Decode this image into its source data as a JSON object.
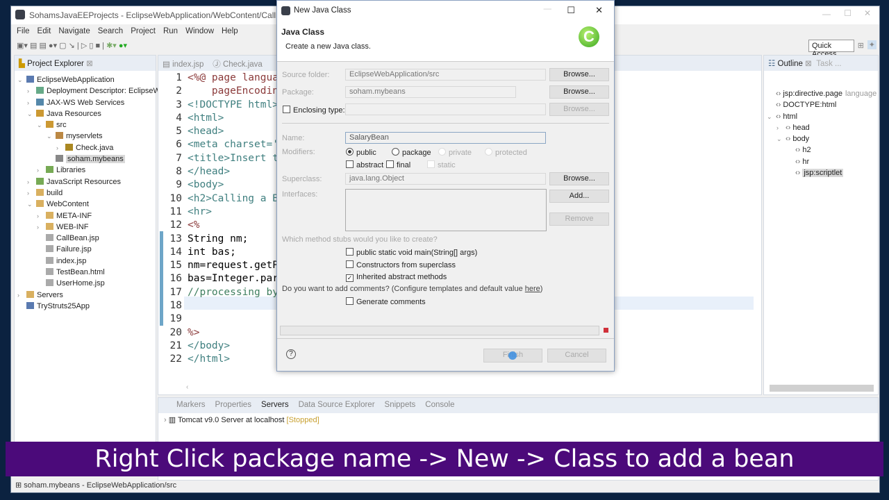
{
  "window": {
    "title": "SohamsJavaEEProjects - EclipseWebApplication/WebContent/CallBean.jsp -"
  },
  "menu": [
    "File",
    "Edit",
    "Navigate",
    "Search",
    "Project",
    "Run",
    "Window",
    "Help"
  ],
  "quick_access": "Quick Access",
  "project_explorer": {
    "title": "Project Explorer",
    "items": [
      {
        "label": "EclipseWebApplication",
        "depth": 0,
        "icon": "project-icon",
        "arrow": "v"
      },
      {
        "label": "Deployment Descriptor: EclipseW",
        "depth": 1,
        "icon": "descriptor-icon",
        "arrow": ">"
      },
      {
        "label": "JAX-WS Web Services",
        "depth": 1,
        "icon": "webservice-icon",
        "arrow": ">"
      },
      {
        "label": "Java Resources",
        "depth": 1,
        "icon": "java-resources-icon",
        "arrow": "v"
      },
      {
        "label": "src",
        "depth": 2,
        "icon": "source-folder-icon",
        "arrow": "v"
      },
      {
        "label": "myservlets",
        "depth": 3,
        "icon": "package-icon",
        "arrow": "v"
      },
      {
        "label": "Check.java",
        "depth": 4,
        "icon": "java-file-icon",
        "arrow": ">"
      },
      {
        "label": "soham.mybeans",
        "depth": 3,
        "icon": "empty-package-icon",
        "arrow": "",
        "selected": true
      },
      {
        "label": "Libraries",
        "depth": 2,
        "icon": "library-icon",
        "arrow": ">"
      },
      {
        "label": "JavaScript Resources",
        "depth": 1,
        "icon": "library-icon",
        "arrow": ">"
      },
      {
        "label": "build",
        "depth": 1,
        "icon": "folder-icon",
        "arrow": ">"
      },
      {
        "label": "WebContent",
        "depth": 1,
        "icon": "folder-icon",
        "arrow": "v"
      },
      {
        "label": "META-INF",
        "depth": 2,
        "icon": "folder-icon",
        "arrow": ">"
      },
      {
        "label": "WEB-INF",
        "depth": 2,
        "icon": "folder-icon",
        "arrow": ">"
      },
      {
        "label": "CallBean.jsp",
        "depth": 2,
        "icon": "file-icon",
        "arrow": ""
      },
      {
        "label": "Failure.jsp",
        "depth": 2,
        "icon": "file-icon",
        "arrow": ""
      },
      {
        "label": "index.jsp",
        "depth": 2,
        "icon": "file-icon",
        "arrow": ""
      },
      {
        "label": "TestBean.html",
        "depth": 2,
        "icon": "file-icon",
        "arrow": ""
      },
      {
        "label": "UserHome.jsp",
        "depth": 2,
        "icon": "file-icon",
        "arrow": ""
      },
      {
        "label": "Servers",
        "depth": 0,
        "icon": "folder-icon",
        "arrow": ">"
      },
      {
        "label": "TryStruts25App",
        "depth": 0,
        "icon": "project-closed-icon",
        "arrow": ""
      }
    ]
  },
  "editor": {
    "tabs": [
      "index.jsp",
      "Check.java"
    ],
    "lines": [
      [
        "1",
        "<%@ page langua"
      ],
      [
        "2",
        "    pageEncodin"
      ],
      [
        "3",
        "<!DOCTYPE html>"
      ],
      [
        "4",
        "<html>"
      ],
      [
        "5",
        "<head>"
      ],
      [
        "6",
        "<meta charset='"
      ],
      [
        "7",
        "<title>Insert t"
      ],
      [
        "8",
        "</head>"
      ],
      [
        "9",
        "<body>"
      ],
      [
        "10",
        "<h2>Calling a B"
      ],
      [
        "11",
        "<hr>"
      ],
      [
        "12",
        "<%"
      ],
      [
        "13",
        "String nm;"
      ],
      [
        "14",
        "int bas;"
      ],
      [
        "15",
        "nm=request.getP"
      ],
      [
        "16",
        "bas=Integer.par"
      ],
      [
        "17",
        "//processing by"
      ],
      [
        "18",
        ""
      ],
      [
        "19",
        ""
      ],
      [
        "20",
        "%>"
      ],
      [
        "21",
        "</body>"
      ],
      [
        "22",
        "</html>"
      ]
    ]
  },
  "outline": {
    "title": "Outline",
    "task_tab": "Task ...",
    "items": [
      {
        "label": "jsp:directive.page",
        "extra": "language",
        "depth": 0,
        "arrow": ""
      },
      {
        "label": "DOCTYPE:html",
        "extra": "",
        "depth": 0,
        "arrow": ""
      },
      {
        "label": "html",
        "extra": "",
        "depth": 0,
        "arrow": "v"
      },
      {
        "label": "head",
        "extra": "",
        "depth": 1,
        "arrow": ">"
      },
      {
        "label": "body",
        "extra": "",
        "depth": 1,
        "arrow": "v"
      },
      {
        "label": "h2",
        "extra": "",
        "depth": 2,
        "arrow": ""
      },
      {
        "label": "hr",
        "extra": "",
        "depth": 2,
        "arrow": ""
      },
      {
        "label": "jsp:scriptlet",
        "extra": "",
        "depth": 2,
        "arrow": "",
        "selected": true
      }
    ]
  },
  "bottom": {
    "tabs": [
      "Markers",
      "Properties",
      "Servers",
      "Data Source Explorer",
      "Snippets",
      "Console"
    ],
    "server": "Tomcat v9.0 Server at localhost",
    "server_status": "[Stopped]"
  },
  "status_bar": "soham.mybeans - EclipseWebApplication/src",
  "dialog": {
    "title": "New Java Class",
    "heading": "Java Class",
    "subtitle": "Create a new Java class.",
    "source_folder_label": "Source folder:",
    "source_folder": "EclipseWebApplication/src",
    "package_label": "Package:",
    "package": "soham.mybeans",
    "enclosing_label": "Enclosing type:",
    "enclosing": "",
    "name_label": "Name:",
    "name": "SalaryBean",
    "modifiers_label": "Modifiers:",
    "modifiers": [
      "public",
      "package",
      "private",
      "protected"
    ],
    "modifiers2": [
      "abstract",
      "final",
      "static"
    ],
    "superclass_label": "Superclass:",
    "superclass": "java.lang.Object",
    "interfaces_label": "Interfaces:",
    "browse": "Browse...",
    "add": "Add...",
    "remove": "Remove",
    "stubs_question": "Which method stubs would you like to create?",
    "stubs": [
      {
        "label": "public static void main(String[] args)",
        "checked": false
      },
      {
        "label": "Constructors from superclass",
        "checked": false
      },
      {
        "label": "Inherited abstract methods",
        "checked": true
      }
    ],
    "comments_question": "Do you want to add comments? (Configure templates and default value ",
    "here_link": "here",
    "comments_close": ")",
    "generate_comments": "Generate comments",
    "finish": "Finish",
    "cancel": "Cancel"
  },
  "caption": "Right Click package name -> New -> Class to add a bean",
  "colors": {
    "caption_bg": "#4b0a7a",
    "desktop": "#0b2240",
    "selection": "#d9d9d9"
  }
}
